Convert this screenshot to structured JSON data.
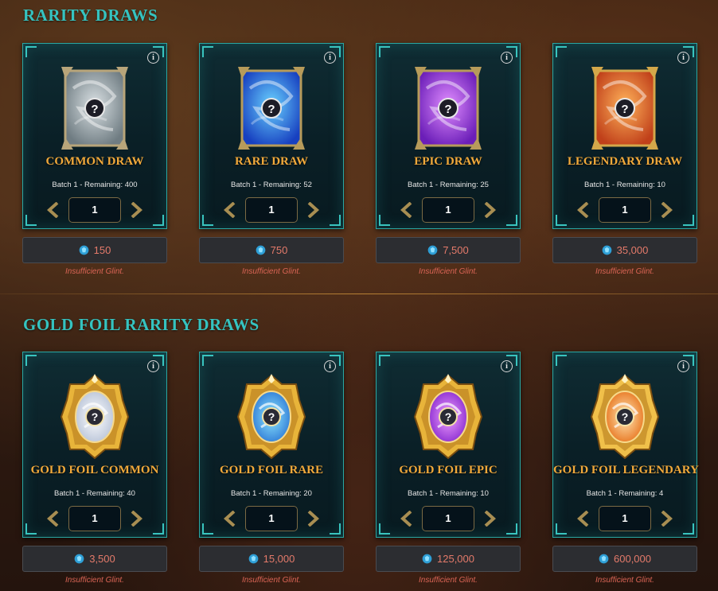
{
  "sections": [
    {
      "title": "RARITY DRAWS",
      "cards": [
        {
          "name": "COMMON DRAW",
          "batch": "Batch 1 - Remaining: 400",
          "qty": "1",
          "price": "150",
          "note": "Insufficient Glint.",
          "theme": "common"
        },
        {
          "name": "RARE DRAW",
          "batch": "Batch 1 - Remaining: 52",
          "qty": "1",
          "price": "750",
          "note": "Insufficient Glint.",
          "theme": "rare"
        },
        {
          "name": "EPIC DRAW",
          "batch": "Batch 1 - Remaining: 25",
          "qty": "1",
          "price": "7,500",
          "note": "Insufficient Glint.",
          "theme": "epic"
        },
        {
          "name": "LEGENDARY DRAW",
          "batch": "Batch 1 - Remaining: 10",
          "qty": "1",
          "price": "35,000",
          "note": "Insufficient Glint.",
          "theme": "legendary"
        }
      ]
    },
    {
      "title": "GOLD FOIL RARITY DRAWS",
      "cards": [
        {
          "name": "GOLD FOIL COMMON",
          "batch": "Batch 1 - Remaining: 40",
          "qty": "1",
          "price": "3,500",
          "note": "Insufficient Glint.",
          "theme": "gold-common"
        },
        {
          "name": "GOLD FOIL RARE",
          "batch": "Batch 1 - Remaining: 20",
          "qty": "1",
          "price": "15,000",
          "note": "Insufficient Glint.",
          "theme": "gold-rare"
        },
        {
          "name": "GOLD FOIL EPIC",
          "batch": "Batch 1 - Remaining: 10",
          "qty": "1",
          "price": "125,000",
          "note": "Insufficient Glint.",
          "theme": "gold-epic"
        },
        {
          "name": "GOLD FOIL LEGENDARY",
          "batch": "Batch 1 - Remaining: 4",
          "qty": "1",
          "price": "600,000",
          "note": "Insufficient Glint.",
          "theme": "gold-legendary"
        }
      ]
    }
  ],
  "icons": {
    "info": "info-icon",
    "currency": "glint-gem-icon",
    "decrement": "chevron-left-icon",
    "increment": "chevron-right-icon"
  },
  "colors": {
    "section_title": "#35c3c0",
    "card_title": "#f1a93b",
    "card_border": "#2aa7a3",
    "price_text": "#e47a6a",
    "warning_text": "#d96455",
    "common": "#a9b4b8",
    "rare": "#2fa6ff",
    "epic": "#b447f0",
    "legendary": "#e8641f",
    "gold": "#e8b43a"
  }
}
